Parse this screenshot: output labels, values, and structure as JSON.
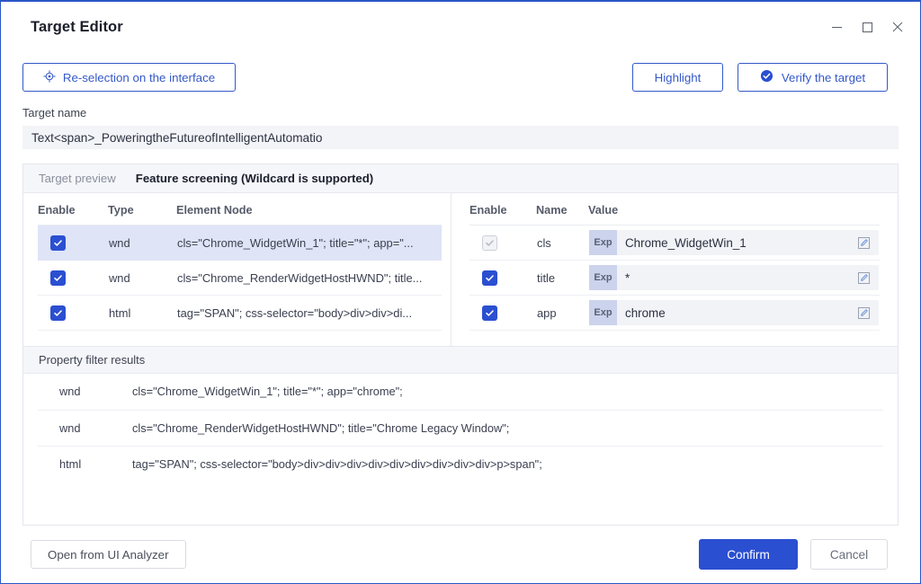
{
  "window": {
    "title": "Target Editor",
    "controls": {
      "minimize": "─",
      "maximize": "□",
      "close": "✕"
    }
  },
  "toolbar": {
    "reselect_label": "Re-selection on the interface",
    "highlight_label": "Highlight",
    "verify_label": "Verify the target"
  },
  "target_name": {
    "label": "Target name",
    "value": "Text<span>_PoweringtheFutureofIntelligentAutomatio"
  },
  "tabs": [
    {
      "label": "Target preview",
      "active": false
    },
    {
      "label": "Feature screening (Wildcard is supported)",
      "active": true
    }
  ],
  "node_table": {
    "columns": [
      "Enable",
      "Type",
      "Element Node"
    ],
    "rows": [
      {
        "enabled": true,
        "selected": true,
        "type": "wnd",
        "node": "cls=\"Chrome_WidgetWin_1\"; title=\"*\"; app=\"..."
      },
      {
        "enabled": true,
        "selected": false,
        "type": "wnd",
        "node": "cls=\"Chrome_RenderWidgetHostHWND\"; title..."
      },
      {
        "enabled": true,
        "selected": false,
        "type": "html",
        "node": "tag=\"SPAN\"; css-selector=\"body>div>div>di..."
      }
    ]
  },
  "property_table": {
    "columns": [
      "Enable",
      "Name",
      "Value"
    ],
    "exp_badge": "Exp",
    "rows": [
      {
        "enabled": true,
        "disabled_checkbox": true,
        "name": "cls",
        "value": "Chrome_WidgetWin_1"
      },
      {
        "enabled": true,
        "disabled_checkbox": false,
        "name": "title",
        "value": "*"
      },
      {
        "enabled": true,
        "disabled_checkbox": false,
        "name": "app",
        "value": "chrome"
      }
    ]
  },
  "filter_results": {
    "title": "Property filter results",
    "rows": [
      {
        "type": "wnd",
        "desc": "cls=\"Chrome_WidgetWin_1\"; title=\"*\"; app=\"chrome\";"
      },
      {
        "type": "wnd",
        "desc": "cls=\"Chrome_RenderWidgetHostHWND\"; title=\"Chrome Legacy Window\";"
      },
      {
        "type": "html",
        "desc": "tag=\"SPAN\"; css-selector=\"body>div>div>div>div>div>div>div>div>div>p>span\";"
      }
    ]
  },
  "footer": {
    "open_analyzer_label": "Open from UI Analyzer",
    "confirm_label": "Confirm",
    "cancel_label": "Cancel"
  },
  "colors": {
    "accent": "#2b4fd1",
    "outline": "#3458c8",
    "selected_row": "#dfe4f7",
    "field_bg": "#f2f4f8",
    "exp_badge": "#ccd3ec"
  }
}
